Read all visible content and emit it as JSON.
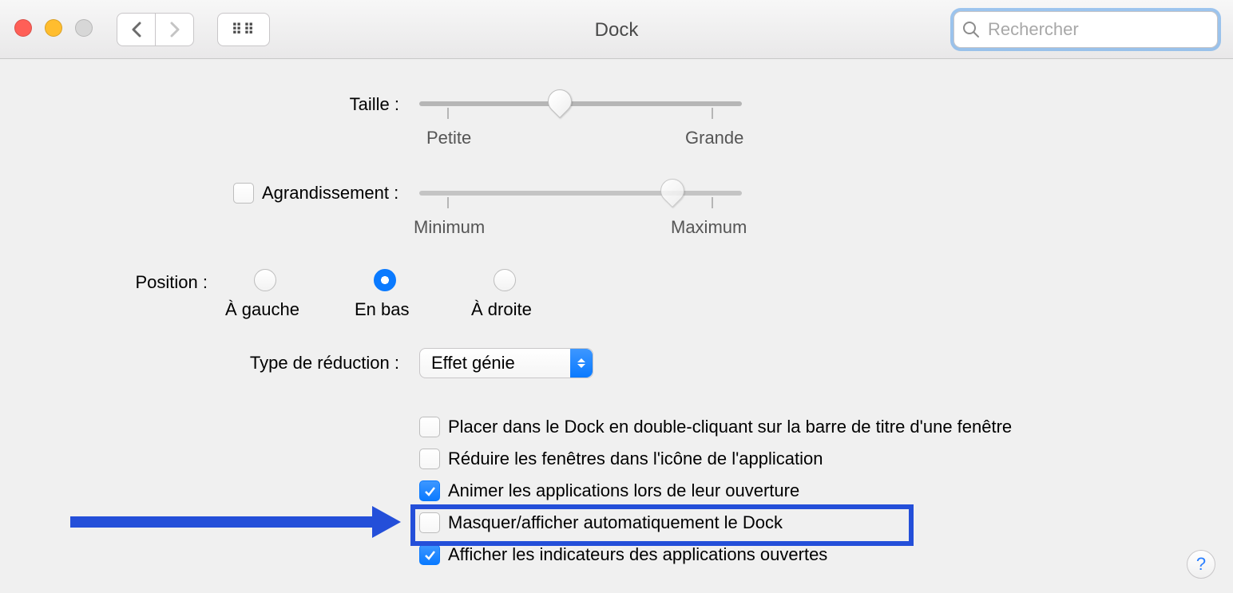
{
  "window": {
    "title": "Dock"
  },
  "search": {
    "placeholder": "Rechercher"
  },
  "labels": {
    "size": "Taille :",
    "magnification": "Agrandissement :",
    "position": "Position :",
    "minimize_type": "Type de réduction :"
  },
  "size_slider": {
    "min_label": "Petite",
    "max_label": "Grande",
    "min_pct": 0,
    "max_pct": 100,
    "value_pct": 42
  },
  "mag_slider": {
    "min_label": "Minimum",
    "max_label": "Maximum",
    "value_pct": 78,
    "enabled": false
  },
  "position_options": {
    "left": "À gauche",
    "bottom": "En bas",
    "right": "À droite",
    "selected": "bottom"
  },
  "minimize_effect": {
    "selected": "Effet génie"
  },
  "checkboxes": {
    "dbl_click": {
      "label": "Placer dans le Dock en double-cliquant sur la barre de titre d'une fenêtre",
      "checked": false
    },
    "reduce_in_icon": {
      "label": "Réduire les fenêtres dans l'icône de l'application",
      "checked": false
    },
    "animate_open": {
      "label": "Animer les applications lors de leur ouverture",
      "checked": true
    },
    "auto_hide": {
      "label": "Masquer/afficher automatiquement le Dock",
      "checked": false
    },
    "show_indicators": {
      "label": "Afficher les indicateurs des applications ouvertes",
      "checked": true
    }
  },
  "help": "?"
}
